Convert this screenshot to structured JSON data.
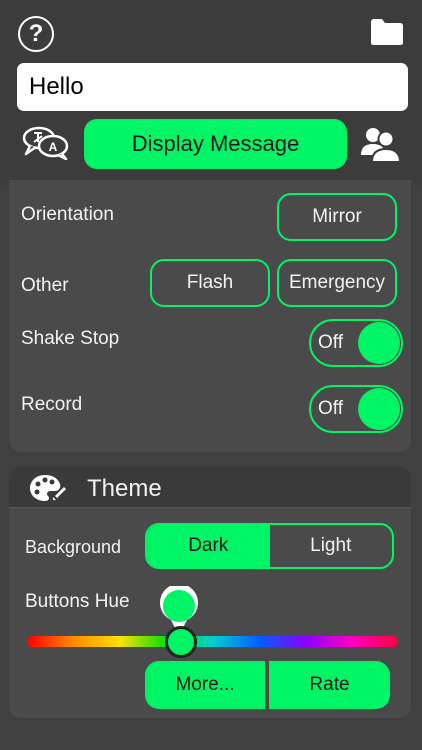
{
  "header": {
    "help_icon": "question-circle-icon",
    "help_symbol": "?",
    "folder_icon": "folder-icon",
    "message_input_value": "Hello",
    "translate_icon": "speech-translate-icon",
    "display_button_label": "Display Message",
    "people_icon": "people-icon"
  },
  "settings": {
    "orientation_label": "Orientation",
    "mirror_label": "Mirror",
    "other_label": "Other",
    "flash_label": "Flash",
    "emergency_label": "Emergency",
    "shake_stop_label": "Shake Stop",
    "shake_stop_value": "Off",
    "record_label": "Record",
    "record_value": "Off"
  },
  "theme": {
    "title": "Theme",
    "palette_icon": "palette-icon",
    "background_label": "Background",
    "background_options": [
      "Dark",
      "Light"
    ],
    "background_selected": "Dark",
    "hue_label": "Buttons Hue",
    "hue_fraction": 0.42,
    "more_label": "More...",
    "rate_label": "Rate"
  },
  "colors": {
    "accent": "#00f566",
    "background": "#404040",
    "panel": "#4a4a4a"
  }
}
